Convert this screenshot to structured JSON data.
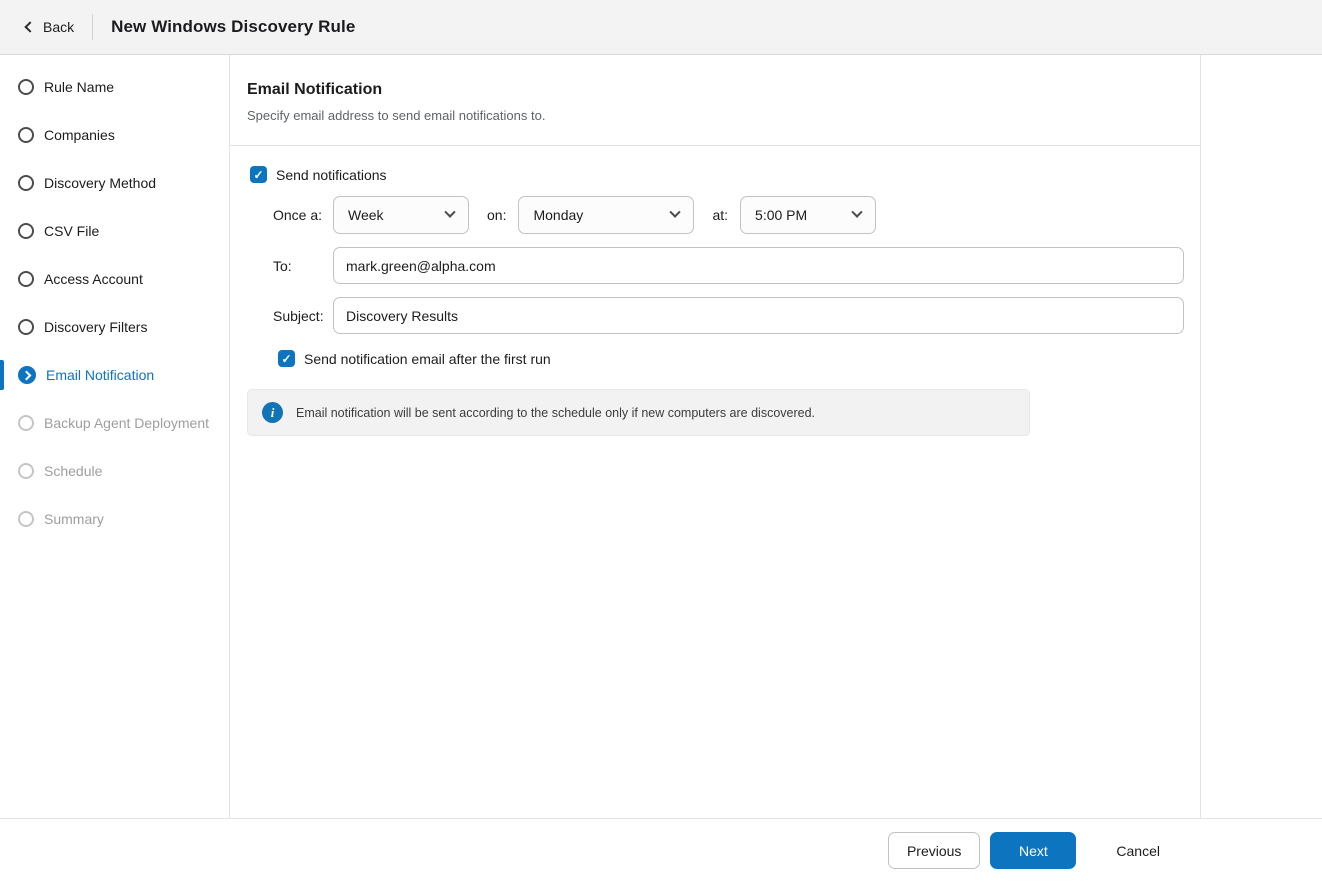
{
  "header": {
    "back_label": "Back",
    "title": "New Windows Discovery Rule"
  },
  "sidebar": {
    "items": [
      {
        "label": "Rule Name",
        "state": "pending"
      },
      {
        "label": "Companies",
        "state": "pending"
      },
      {
        "label": "Discovery Method",
        "state": "pending"
      },
      {
        "label": "CSV File",
        "state": "pending"
      },
      {
        "label": "Access Account",
        "state": "pending"
      },
      {
        "label": "Discovery Filters",
        "state": "pending"
      },
      {
        "label": "Email Notification",
        "state": "active"
      },
      {
        "label": "Backup Agent Deployment",
        "state": "disabled"
      },
      {
        "label": "Schedule",
        "state": "disabled"
      },
      {
        "label": "Summary",
        "state": "disabled"
      }
    ]
  },
  "main": {
    "title": "Email Notification",
    "subtitle": "Specify email address to send email notifications to.",
    "send_notifications": {
      "label": "Send notifications",
      "checked": true
    },
    "schedule": {
      "once_label": "Once a:",
      "period_value": "Week",
      "on_label": "on:",
      "day_value": "Monday",
      "at_label": "at:",
      "time_value": "5:00 PM"
    },
    "to": {
      "label": "To:",
      "value": "mark.green@alpha.com"
    },
    "subject": {
      "label": "Subject:",
      "value": "Discovery Results"
    },
    "first_run": {
      "label": "Send notification email after the first run",
      "checked": true
    },
    "info": {
      "text": "Email notification will be sent according to the schedule only if new computers are discovered."
    }
  },
  "footer": {
    "previous_label": "Previous",
    "next_label": "Next",
    "cancel_label": "Cancel"
  },
  "colors": {
    "accent": "#0d74bf",
    "info_icon": "#1273b5"
  }
}
